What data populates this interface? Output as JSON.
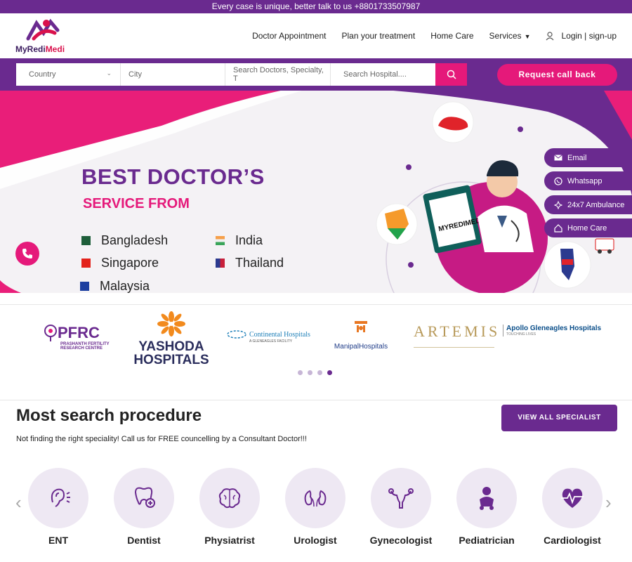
{
  "topbar": {
    "text": "Every case is unique, better talk to us +8801733507987"
  },
  "brand": {
    "name_part1": "MyRedi",
    "name_part2": "Medi"
  },
  "nav": {
    "items": [
      "Doctor Appointment",
      "Plan your treatment",
      "Home Care",
      "Services"
    ],
    "login": "Login | sign-up"
  },
  "search": {
    "country_placeholder": "Country",
    "city_placeholder": "City",
    "doctor_placeholder": "Search Doctors, Specialty, T",
    "hospital_placeholder": "Search Hospital....",
    "callback_label": "Request call back"
  },
  "hero": {
    "title": "BEST DOCTOR’S",
    "subtitle": "SERVICE FROM",
    "countries": [
      "Bangladesh",
      "India",
      "Singapore",
      "Thailand",
      "Malaysia"
    ],
    "clipboard_text": "MYREDIMEDI"
  },
  "side_tabs": [
    "Email",
    "Whatsapp",
    "24x7 Ambulance",
    "Home Care"
  ],
  "partners": {
    "pfrc_title": "PFRC",
    "pfrc_sub1": "PRASHANTH FERTILITY",
    "pfrc_sub2": "RESEARCH CENTRE",
    "yashoda1": "YASHODA",
    "yashoda2": "HOSPITALS",
    "continental": "Continental Hospitals",
    "continental_sub": "A GLENEAGLES FACILITY",
    "manipal": "ManipalHospitals",
    "artemis": "ARTEMIS",
    "apollo": "Apollo Gleneagles Hospitals",
    "apollo_sub": "TOUCHING LIVES"
  },
  "procedures": {
    "title": "Most search procedure",
    "subtitle": "Not finding the right speciality! Call us for FREE councelling by a Consultant Doctor!!!",
    "view_all": "VIEW ALL SPECIALIST",
    "specialties": [
      "ENT",
      "Dentist",
      "Physiatrist",
      "Urologist",
      "Gynecologist",
      "Pediatrician",
      "Cardiologist"
    ]
  },
  "colors": {
    "purple": "#6a2a8f",
    "pink": "#e5197a"
  }
}
